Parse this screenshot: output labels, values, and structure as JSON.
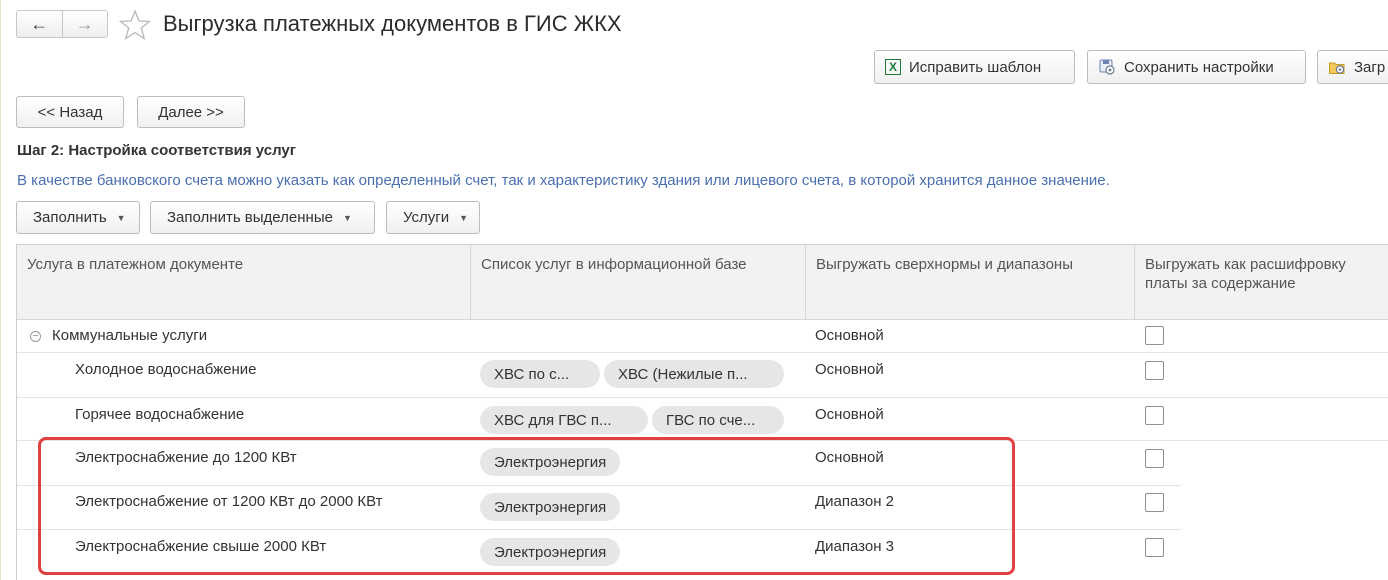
{
  "window": {
    "title": "Выгрузка платежных документов в ГИС ЖКХ"
  },
  "toolbar": {
    "fix_template_label": "Исправить шаблон",
    "save_settings_label": "Сохранить настройки",
    "load_label": "Загр"
  },
  "navigation": {
    "back_label": "<< Назад",
    "next_label": "Далее >>"
  },
  "step": {
    "title": "Шаг 2: Настройка соответствия услуг",
    "hint": "В качестве банковского счета можно указать как определенный счет, так и характеристику здания или лицевого счета, в которой хранится данное значение."
  },
  "actions": {
    "fill_label": "Заполнить",
    "fill_selected_label": "Заполнить выделенные",
    "services_label": "Услуги"
  },
  "table": {
    "columns": [
      "Услуга в платежном документе",
      "Список услуг в информационной базе",
      "Выгружать сверхнормы и диапазоны",
      "Выгружать как расшифровку платы за содержание"
    ],
    "rows": [
      {
        "service": "Коммунальные услуги",
        "ib_services": [],
        "mode": "Основной",
        "breakdown": false,
        "group": true
      },
      {
        "service": "Холодное водоснабжение",
        "ib_services": [
          "ХВС по с...",
          "ХВС (Нежилые п..."
        ],
        "mode": "Основной",
        "breakdown": false
      },
      {
        "service": "Горячее водоснабжение",
        "ib_services": [
          "ХВС для ГВС п...",
          "ГВС по сче..."
        ],
        "mode": "Основной",
        "breakdown": false
      },
      {
        "service": "Электроснабжение до 1200 КВт",
        "ib_services": [
          "Электроэнергия"
        ],
        "mode": "Основной",
        "breakdown": false
      },
      {
        "service": "Электроснабжение  от 1200 КВт до 2000 КВт",
        "ib_services": [
          "Электроэнергия"
        ],
        "mode": "Диапазон 2",
        "breakdown": false
      },
      {
        "service": "Электроснабжение свыше 2000 КВт",
        "ib_services": [
          "Электроэнергия"
        ],
        "mode": "Диапазон 3",
        "breakdown": false
      }
    ]
  },
  "colors": {
    "hint_text": "#4a6fb0",
    "highlight_border": "#e0403f",
    "chip_bg": "#e6e6e6",
    "excel_green": "#1f7a3a"
  }
}
